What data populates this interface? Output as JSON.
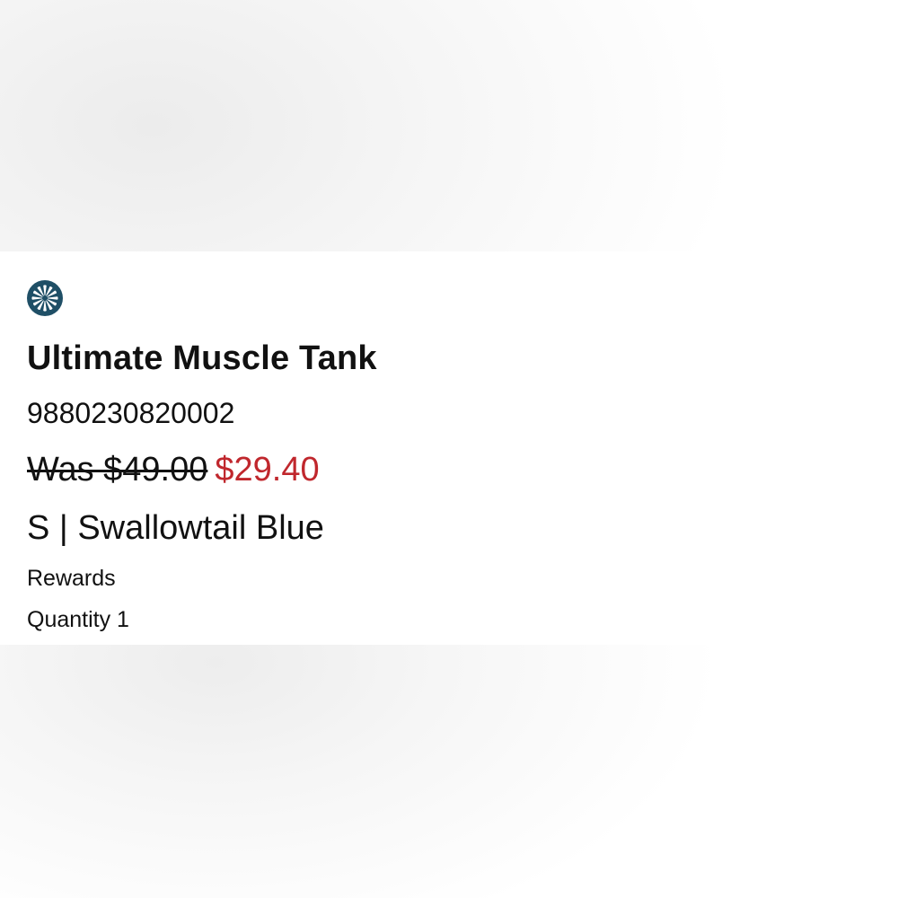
{
  "product": {
    "brand_icon": "pinwheel-logo-icon",
    "title": "Ultimate Muscle Tank",
    "sku": "9880230820002",
    "was_price": "Was $49.00",
    "sale_price": "$29.40",
    "variant": "S | Swallowtail Blue",
    "rewards_label": "Rewards",
    "quantity_label": "Quantity 1"
  },
  "colors": {
    "sale_price": "#c0272d",
    "logo_bg": "#1f4f66"
  }
}
